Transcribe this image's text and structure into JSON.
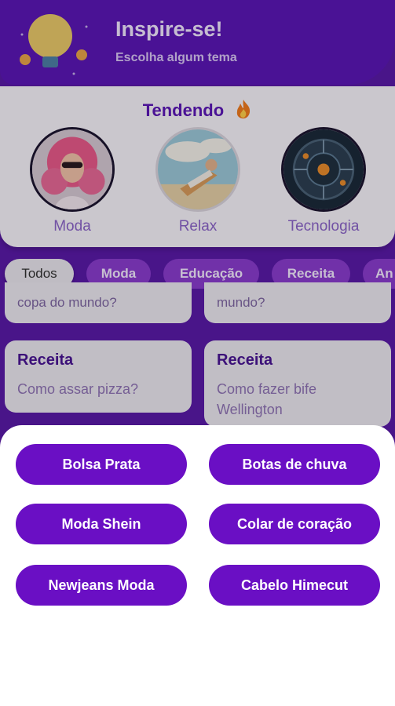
{
  "header": {
    "title": "Inspire-se!",
    "subtitle": "Escolha algum tema"
  },
  "trending": {
    "title": "Tendendo",
    "items": [
      {
        "label": "Moda"
      },
      {
        "label": "Relax"
      },
      {
        "label": "Tecnologia"
      }
    ]
  },
  "filters": [
    "Todos",
    "Moda",
    "Educação",
    "Receita",
    "An"
  ],
  "cards": [
    {
      "text": "copa do mundo?"
    },
    {
      "text": "mundo?"
    },
    {
      "category": "Receita",
      "text": "Como assar pizza?"
    },
    {
      "category": "Receita",
      "text": "Como fazer bife Wellington"
    }
  ],
  "options": [
    "Bolsa Prata",
    "Botas de chuva",
    "Moda Shein",
    "Colar de coração",
    "Newjeans Moda",
    "Cabelo Himecut"
  ],
  "colors": {
    "primary": "#6a0fc4",
    "header": "#5b17b6",
    "chip": "#8a3ccf"
  }
}
